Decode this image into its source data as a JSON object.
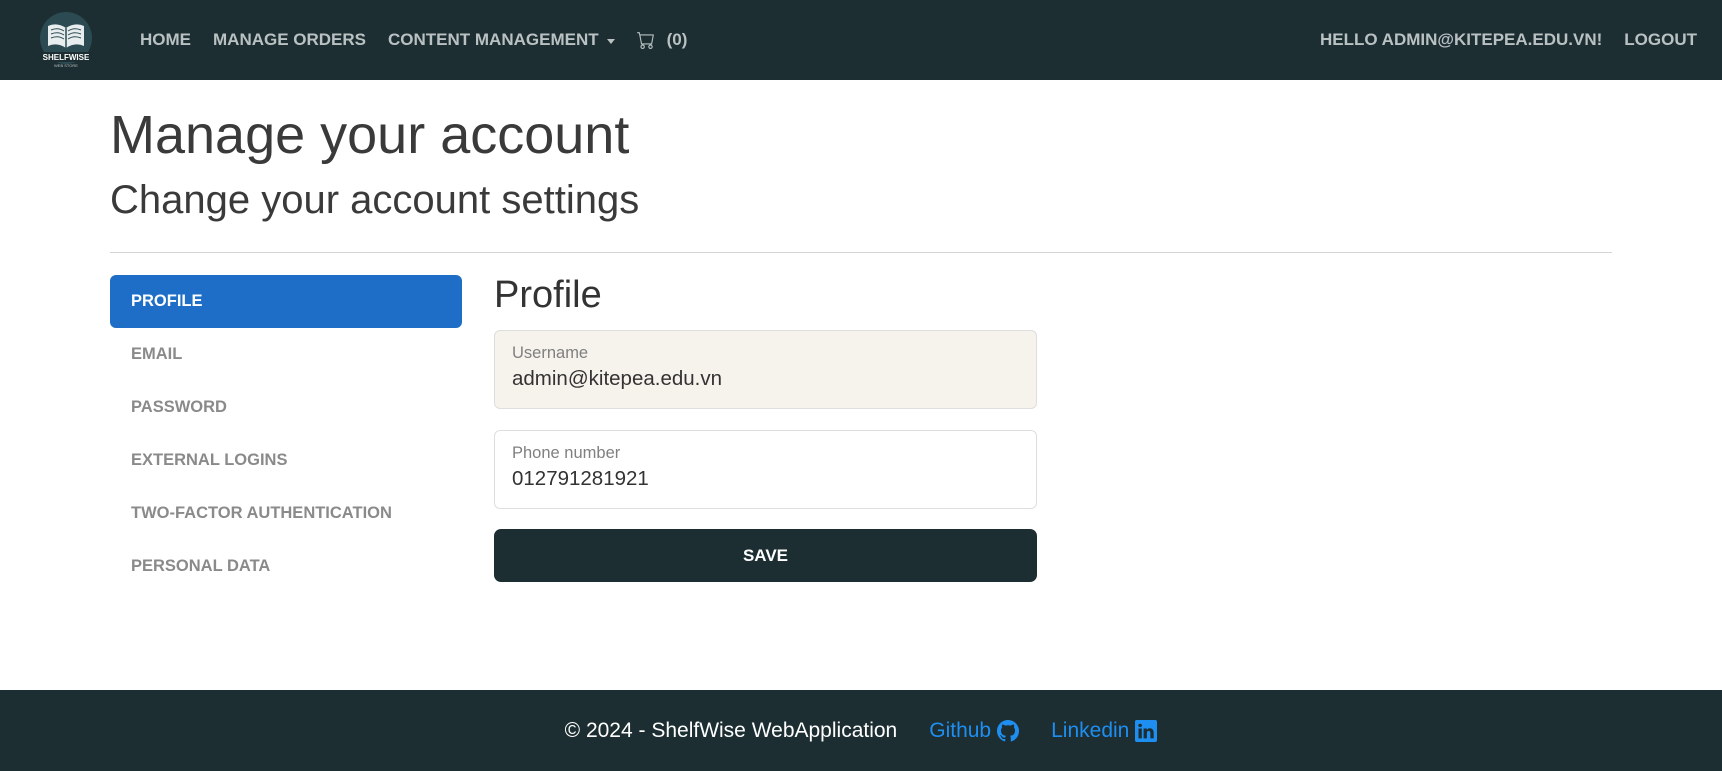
{
  "navbar": {
    "logo_text": "SHELFWISE",
    "logo_subtext": "WEB STORE",
    "links": [
      "HOME",
      "MANAGE ORDERS"
    ],
    "dropdown_label": "CONTENT MANAGEMENT",
    "cart_count": "(0)",
    "greeting": "HELLO ADMIN@KITEPEA.EDU.VN!",
    "logout": "LOGOUT"
  },
  "page": {
    "title": "Manage your account",
    "subtitle": "Change your account settings"
  },
  "sidenav": {
    "items": [
      {
        "label": "PROFILE",
        "active": true
      },
      {
        "label": "EMAIL",
        "active": false
      },
      {
        "label": "PASSWORD",
        "active": false
      },
      {
        "label": "EXTERNAL LOGINS",
        "active": false
      },
      {
        "label": "TWO-FACTOR AUTHENTICATION",
        "active": false
      },
      {
        "label": "PERSONAL DATA",
        "active": false
      }
    ]
  },
  "profile": {
    "section_title": "Profile",
    "username": {
      "label": "Username",
      "value": "admin@kitepea.edu.vn"
    },
    "phone": {
      "label": "Phone number",
      "value": "012791281921"
    },
    "save_label": "SAVE"
  },
  "footer": {
    "copyright": "© 2024 - ShelfWise WebApplication",
    "github_label": "Github",
    "linkedin_label": "Linkedin"
  },
  "colors": {
    "navbar_bg": "#1c2e32",
    "accent_blue": "#1e6ec8",
    "link_blue": "#1f8ef1",
    "readonly_field_bg": "#f6f2ec"
  },
  "icons": {
    "cart": "cart-icon",
    "github": "github-icon",
    "linkedin": "linkedin-icon",
    "dropdown": "caret-down-icon"
  }
}
